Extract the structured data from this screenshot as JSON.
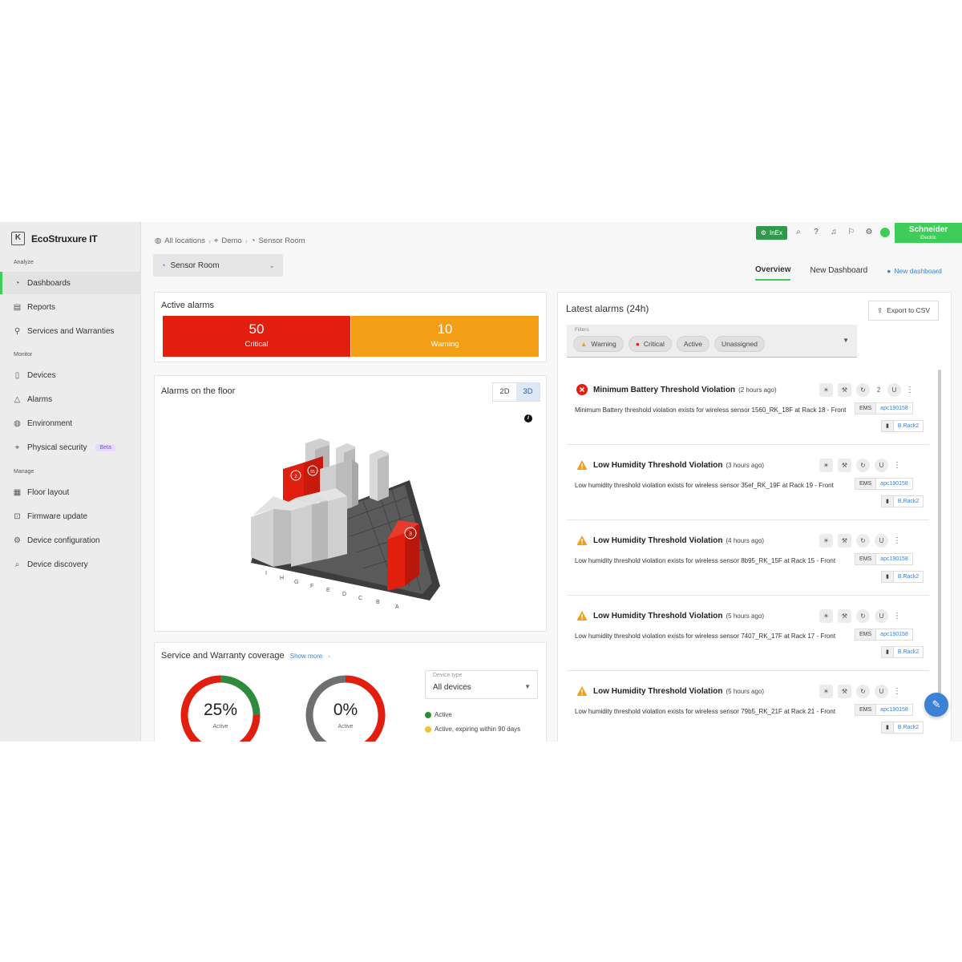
{
  "brand": {
    "name": "EcoStruxure IT",
    "box_glyph": "K"
  },
  "sidebar": {
    "sections": [
      {
        "label": "Analyze"
      },
      {
        "label": "Monitor"
      },
      {
        "label": "Manage"
      }
    ],
    "items": [
      {
        "label": "Dashboards",
        "icon": "dashboard-icon",
        "active": true
      },
      {
        "label": "Reports",
        "icon": "report-icon"
      },
      {
        "label": "Services and Warranties",
        "icon": "services-icon"
      },
      {
        "label": "Devices",
        "icon": "device-icon"
      },
      {
        "label": "Alarms",
        "icon": "alarm-icon"
      },
      {
        "label": "Environment",
        "icon": "environment-icon"
      },
      {
        "label": "Physical security",
        "icon": "security-icon",
        "badge": "Beta"
      },
      {
        "label": "Floor layout",
        "icon": "floor-layout-icon"
      },
      {
        "label": "Firmware update",
        "icon": "firmware-icon"
      },
      {
        "label": "Device configuration",
        "icon": "config-icon"
      },
      {
        "label": "Device discovery",
        "icon": "discovery-icon"
      }
    ]
  },
  "breadcrumb": [
    "All locations",
    "Demo",
    "Sensor Room"
  ],
  "location_select": {
    "value": "Sensor Room"
  },
  "topbar": {
    "inex_label": "InEx",
    "brand_logo": "Schneider",
    "brand_logo_sub": "Electric"
  },
  "tabs": [
    {
      "label": "Overview",
      "active": true
    },
    {
      "label": "New Dashboard"
    }
  ],
  "new_dashboard_link": "New dashboard",
  "active_alarms": {
    "title": "Active alarms",
    "critical": {
      "count": "50",
      "label": "Critical",
      "color": "#e21e0e"
    },
    "warning": {
      "count": "10",
      "label": "Warning",
      "color": "#f29f17"
    }
  },
  "floor": {
    "title": "Alarms on the floor",
    "toggle": {
      "two_d": "2D",
      "three_d": "3D",
      "selected": "3D"
    },
    "info": "i",
    "row_letters": [
      "I",
      "H",
      "G",
      "F",
      "E",
      "D",
      "C",
      "B",
      "A"
    ],
    "rack_badges": [
      "2",
      "55",
      "3"
    ]
  },
  "warranty": {
    "title": "Service and Warranty coverage",
    "show_more": "Show more",
    "donut1": {
      "pct": "25%",
      "label": "Active",
      "active_fraction": 0.25
    },
    "donut2": {
      "pct": "0%",
      "label": "Active",
      "active_fraction": 0.0
    },
    "device_type": {
      "label": "Device type",
      "value": "All devices"
    },
    "legend": [
      {
        "label": "Active",
        "color": "#2e8b3d"
      },
      {
        "label": "Active, expiring within 90 days",
        "color": "#f4c430"
      }
    ]
  },
  "latest_alarms": {
    "title": "Latest alarms (24h)",
    "export_label": "Export to CSV",
    "filters_label": "Filters",
    "filter_chips": [
      {
        "label": "Warning",
        "icon": "warning-icon"
      },
      {
        "label": "Critical",
        "icon": "critical-icon"
      },
      {
        "label": "Active"
      },
      {
        "label": "Unassigned"
      }
    ],
    "items": [
      {
        "severity": "critical",
        "title": "Minimum Battery Threshold Violation",
        "time": "(2 hours ago)",
        "desc": "Minimum Battery threshold violation exists for wireless sensor 1560_RK_18F at Rack 18 - Front",
        "tag1_key": "EMS",
        "tag1_val": "apc190158",
        "tag2_val": "B.Rack2",
        "count": "2"
      },
      {
        "severity": "warning",
        "title": "Low Humidity Threshold Violation",
        "time": "(3 hours ago)",
        "desc": "Low humidity threshold violation exists for wireless sensor 35ef_RK_19F at Rack 19 - Front",
        "tag1_key": "EMS",
        "tag1_val": "apc190158",
        "tag2_val": "B.Rack2"
      },
      {
        "severity": "warning",
        "title": "Low Humidity Threshold Violation",
        "time": "(4 hours ago)",
        "desc": "Low humidity threshold violation exists for wireless sensor 8b95_RK_15F at Rack 15 - Front",
        "tag1_key": "EMS",
        "tag1_val": "apc190158",
        "tag2_val": "B.Rack2"
      },
      {
        "severity": "warning",
        "title": "Low Humidity Threshold Violation",
        "time": "(5 hours ago)",
        "desc": "Low humidity threshold violation exists for wireless sensor 7407_RK_17F at Rack 17 - Front",
        "tag1_key": "EMS",
        "tag1_val": "apc190158",
        "tag2_val": "B.Rack2"
      },
      {
        "severity": "warning",
        "title": "Low Humidity Threshold Violation",
        "time": "(5 hours ago)",
        "desc": "Low humidity threshold violation exists for wireless sensor 79b5_RK_21F at Rack 21 - Front",
        "tag1_key": "EMS",
        "tag1_val": "apc190158",
        "tag2_val": "B.Rack2"
      }
    ]
  }
}
